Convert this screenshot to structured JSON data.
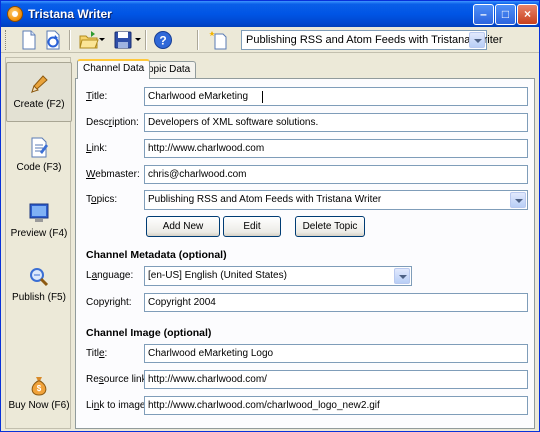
{
  "window": {
    "title": "Tristana Writer"
  },
  "toolbar": {
    "topic_select_value": "Publishing RSS and Atom Feeds with Tristana Writer",
    "icons": [
      "new-document-icon",
      "refresh-icon",
      "open-folder-icon",
      "save-disk-icon",
      "help-icon",
      "new-topic-icon"
    ]
  },
  "sidebar": {
    "items": [
      {
        "label": "Create (F2)",
        "icon": "pencil-icon",
        "active": true
      },
      {
        "label": "Code (F3)",
        "icon": "code-icon"
      },
      {
        "label": "Preview (F4)",
        "icon": "monitor-icon"
      },
      {
        "label": "Publish (F5)",
        "icon": "publish-icon"
      },
      {
        "label": "Buy Now (F6)",
        "icon": "money-bag-icon"
      }
    ]
  },
  "tabs": [
    {
      "label": "Channel Data",
      "active": true
    },
    {
      "label": "Topic Data"
    }
  ],
  "channel": {
    "title_label_u": "T",
    "title_label_rest": "itle:",
    "title_value": "Charlwood eMarketing",
    "description_label_a": "Desc",
    "description_label_u": "r",
    "description_label_b": "iption:",
    "description_value": "Developers of XML software solutions.",
    "link_label_u": "L",
    "link_label_rest": "ink:",
    "link_value": "http://www.charlwood.com",
    "webmaster_label_u": "W",
    "webmaster_label_rest": "ebmaster:",
    "webmaster_value": "chris@charlwood.com",
    "topics_label_a": "T",
    "topics_label_u": "o",
    "topics_label_b": "pics:",
    "topics_value": "Publishing RSS and Atom Feeds with Tristana Writer",
    "add_new_label": "Add New",
    "edit_label": "Edit",
    "delete_label": "Delete Topic"
  },
  "metadata": {
    "heading": "Channel Metadata (optional)",
    "language_label_a": "L",
    "language_label_u": "a",
    "language_label_b": "nguage:",
    "language_value": "[en-US] English (United States)",
    "copyright_label_a": "Copyri",
    "copyright_label_u": "g",
    "copyright_label_b": "ht:",
    "copyright_value": "Copyright 2004"
  },
  "image": {
    "heading": "Channel Image (optional)",
    "title_label_a": "Titl",
    "title_label_u": "e",
    "title_label_b": ":",
    "title_value": "Charlwood eMarketing Logo",
    "resource_label_a": "Re",
    "resource_label_u": "s",
    "resource_label_b": "ource link:",
    "resource_value": "http://www.charlwood.com/",
    "link_image_label_a": "Li",
    "link_image_label_u": "n",
    "link_image_label_b": "k to image:",
    "link_image_value": "http://www.charlwood.com/charlwood_logo_new2.gif"
  }
}
